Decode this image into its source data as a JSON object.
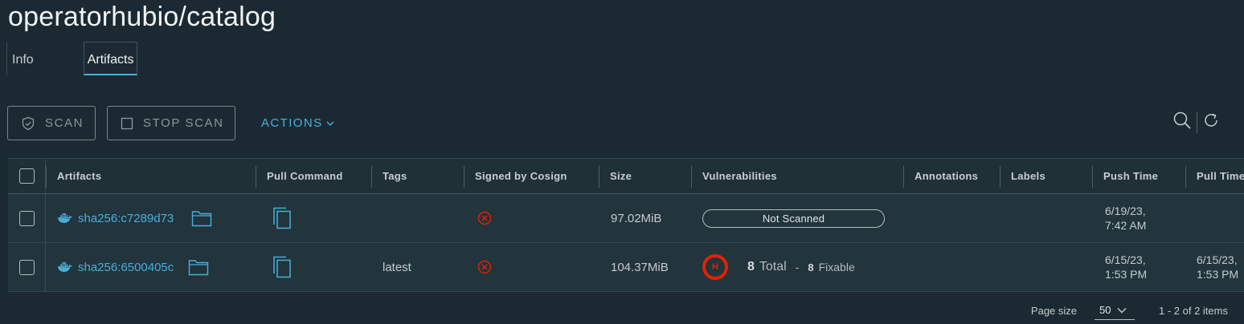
{
  "page": {
    "title": "operatorhubio/catalog"
  },
  "tabs": [
    {
      "label": "Info",
      "active": false
    },
    {
      "label": "Artifacts",
      "active": true
    }
  ],
  "toolbar": {
    "scan_label": "SCAN",
    "stop_scan_label": "STOP SCAN",
    "actions_label": "ACTIONS"
  },
  "table": {
    "columns": [
      "Artifacts",
      "Pull Command",
      "Tags",
      "Signed by Cosign",
      "Size",
      "Vulnerabilities",
      "Annotations",
      "Labels",
      "Push Time",
      "Pull Time"
    ],
    "rows": [
      {
        "digest": "sha256:c7289d73",
        "tags": "",
        "signed": false,
        "size": "97.02MiB",
        "vulnerabilities": {
          "status": "Not Scanned"
        },
        "push_time_line1": "6/19/23,",
        "push_time_line2": "7:42 AM",
        "pull_time_line1": "",
        "pull_time_line2": ""
      },
      {
        "digest": "sha256:6500405c",
        "tags": "latest",
        "signed": false,
        "size": "104.37MiB",
        "vulnerabilities": {
          "severity": "H",
          "total_count": "8",
          "total_label": "Total",
          "separator": "-",
          "fixable_count": "8",
          "fixable_label": "Fixable"
        },
        "push_time_line1": "6/15/23,",
        "push_time_line2": "1:53 PM",
        "pull_time_line1": "6/15/23,",
        "pull_time_line2": "1:53 PM"
      }
    ]
  },
  "footer": {
    "page_size_label": "Page size",
    "page_size_value": "50",
    "items_summary": "1 - 2 of 2 items"
  },
  "colors": {
    "background": "#1b2a32",
    "accent": "#49afd9",
    "danger": "#e12200"
  },
  "icons": [
    "shield-check-icon",
    "stop-square-icon",
    "chevron-down-icon",
    "search-icon",
    "refresh-icon",
    "docker-whale-icon",
    "folder-icon",
    "copy-icon",
    "error-circle-icon"
  ]
}
